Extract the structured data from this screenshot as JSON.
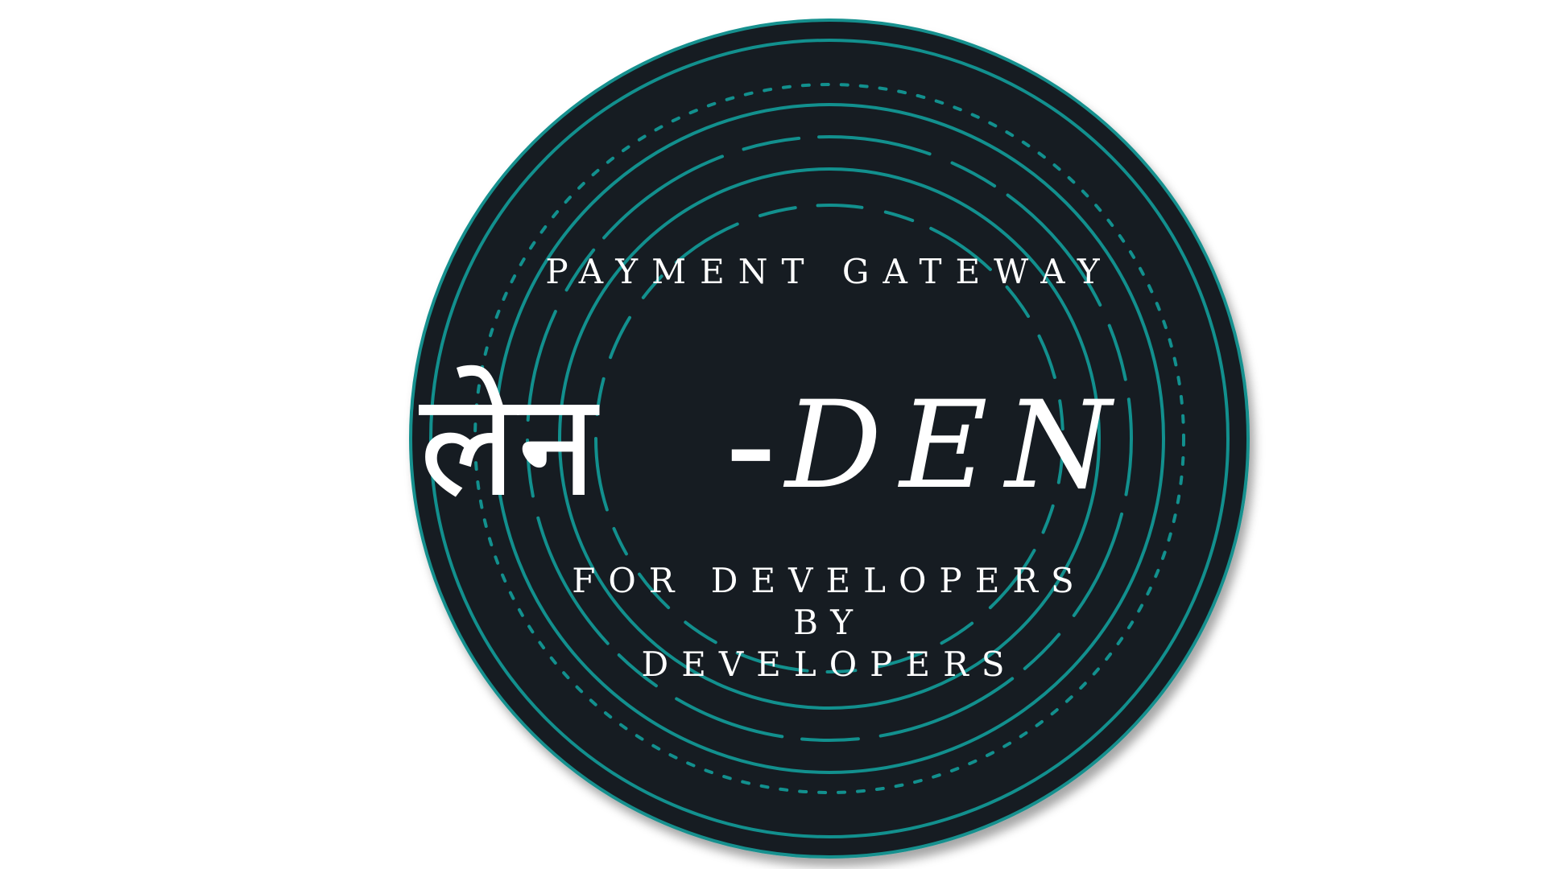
{
  "logo": {
    "tagline_top": "PAYMENT GATEWAY",
    "brand_devanagari": "लेन",
    "brand_dash": "-",
    "brand_latin": "DEN",
    "tagline_line1": "FOR DEVELOPERS",
    "tagline_line2": "BY",
    "tagline_line3": "DEVELOPERS"
  },
  "colors": {
    "background": "#ffffff",
    "badge_fill": "#181c20",
    "accent_teal": "#12908e",
    "text": "#ffffff"
  }
}
